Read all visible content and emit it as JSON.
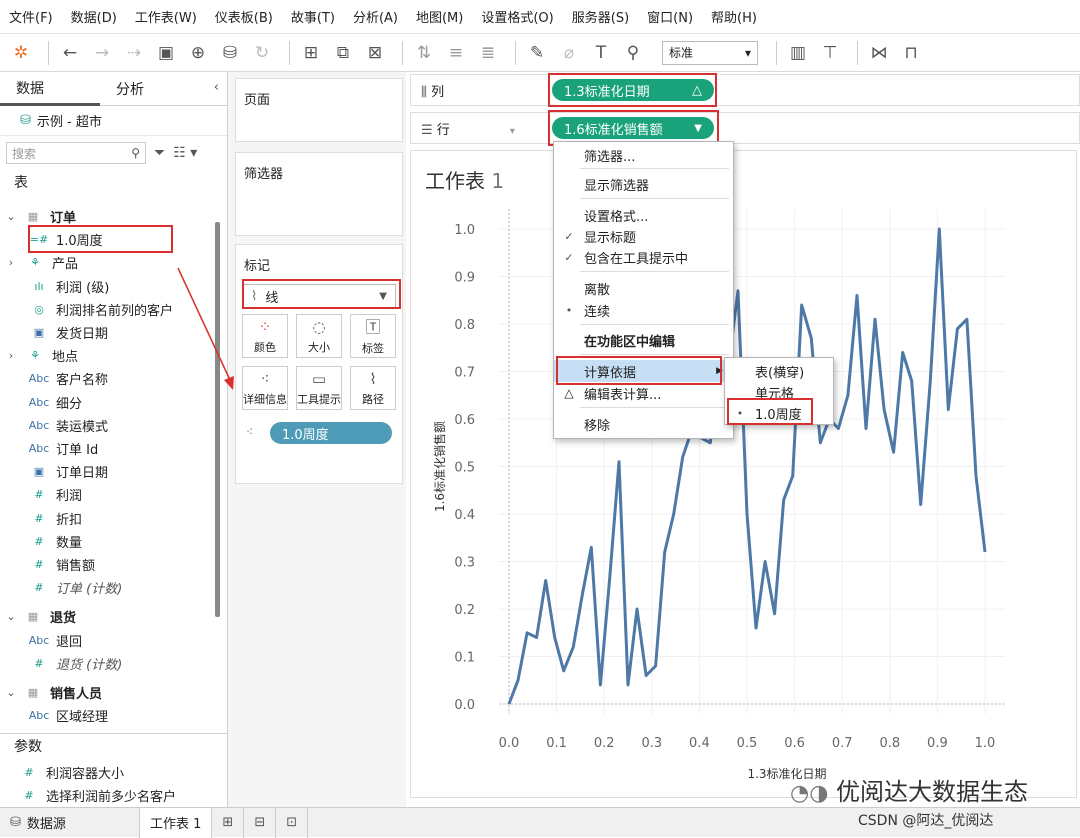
{
  "menubar": [
    "文件(F)",
    "数据(D)",
    "工作表(W)",
    "仪表板(B)",
    "故事(T)",
    "分析(A)",
    "地图(M)",
    "设置格式(O)",
    "服务器(S)",
    "窗口(N)",
    "帮助(H)"
  ],
  "toolbar": {
    "fit_select": "标准"
  },
  "left": {
    "tab_data": "数据",
    "tab_analysis": "分析",
    "datasource": "示例 - 超市",
    "search_placeholder": "搜索",
    "tables_heading": "表",
    "fields": [
      {
        "label": "订单",
        "kind": "table",
        "bold": true,
        "expand": "⌄"
      },
      {
        "label": "1.0周度",
        "kind": "calc"
      },
      {
        "label": "产品",
        "kind": "hier",
        "expand": "›"
      },
      {
        "label": "利润 (级)",
        "kind": "bin"
      },
      {
        "label": "利润排名前列的客户",
        "kind": "set"
      },
      {
        "label": "发货日期",
        "kind": "date"
      },
      {
        "label": "地点",
        "kind": "hier",
        "expand": "›"
      },
      {
        "label": "客户名称",
        "kind": "abc"
      },
      {
        "label": "细分",
        "kind": "abc"
      },
      {
        "label": "装运模式",
        "kind": "abc"
      },
      {
        "label": "订单 Id",
        "kind": "abc"
      },
      {
        "label": "订单日期",
        "kind": "date"
      },
      {
        "label": "利润",
        "kind": "num"
      },
      {
        "label": "折扣",
        "kind": "num"
      },
      {
        "label": "数量",
        "kind": "num"
      },
      {
        "label": "销售额",
        "kind": "num"
      },
      {
        "label": "订单 (计数)",
        "kind": "num",
        "italic": true
      },
      {
        "label": "退货",
        "kind": "table",
        "bold": true,
        "expand": "⌄"
      },
      {
        "label": "退回",
        "kind": "abc"
      },
      {
        "label": "退货 (计数)",
        "kind": "num",
        "italic": true
      },
      {
        "label": "销售人员",
        "kind": "table",
        "bold": true,
        "expand": "⌄"
      },
      {
        "label": "区域经理",
        "kind": "abc"
      }
    ],
    "params_heading": "参数",
    "params": [
      "利润容器大小",
      "选择利润前多少名客户"
    ]
  },
  "cards": {
    "pages": "页面",
    "filters": "筛选器",
    "marks": "标记",
    "mark_type": "线",
    "mark_buttons": [
      "颜色",
      "大小",
      "标签",
      "详细信息",
      "工具提示",
      "路径"
    ],
    "detail_pill": "1.0周度"
  },
  "shelves": {
    "columns_label": "列",
    "rows_label": "行",
    "col_pill": "1.3标准化日期",
    "row_pill": "1.6标准化销售额"
  },
  "viz": {
    "sheet_title": "工作表",
    "sheet_num": "1"
  },
  "chart_data": {
    "type": "line",
    "xlabel": "1.3标准化日期",
    "ylabel": "1.6标准化销售额",
    "xlim": [
      0,
      1
    ],
    "ylim": [
      0,
      1
    ],
    "xticks": [
      "0.0",
      "0.1",
      "0.2",
      "0.3",
      "0.4",
      "0.5",
      "0.6",
      "0.7",
      "0.8",
      "0.9",
      "1.0"
    ],
    "yticks": [
      "0.0",
      "0.1",
      "0.2",
      "0.3",
      "0.4",
      "0.5",
      "0.6",
      "0.7",
      "0.8",
      "0.9",
      "1.0"
    ],
    "color": "#4e79a7",
    "x": [
      0.0,
      0.019,
      0.038,
      0.058,
      0.077,
      0.096,
      0.115,
      0.135,
      0.154,
      0.173,
      0.192,
      0.212,
      0.231,
      0.25,
      0.269,
      0.288,
      0.308,
      0.327,
      0.346,
      0.365,
      0.385,
      0.404,
      0.423,
      0.442,
      0.462,
      0.481,
      0.5,
      0.519,
      0.538,
      0.558,
      0.577,
      0.596,
      0.615,
      0.635,
      0.654,
      0.673,
      0.692,
      0.712,
      0.731,
      0.75,
      0.769,
      0.788,
      0.808,
      0.827,
      0.846,
      0.865,
      0.885,
      0.904,
      0.923,
      0.942,
      0.962,
      0.981,
      1.0
    ],
    "y": [
      0.0,
      0.05,
      0.15,
      0.14,
      0.26,
      0.14,
      0.07,
      0.12,
      0.23,
      0.33,
      0.04,
      0.27,
      0.51,
      0.04,
      0.2,
      0.06,
      0.08,
      0.32,
      0.4,
      0.52,
      0.58,
      0.56,
      0.55,
      0.7,
      0.72,
      0.87,
      0.4,
      0.16,
      0.3,
      0.19,
      0.43,
      0.48,
      0.84,
      0.77,
      0.55,
      0.6,
      0.58,
      0.65,
      0.86,
      0.58,
      0.81,
      0.62,
      0.53,
      0.74,
      0.68,
      0.42,
      0.68,
      1.0,
      0.62,
      0.79,
      0.81,
      0.48,
      0.32
    ]
  },
  "context_menu": {
    "items": [
      "筛选器...",
      "显示筛选器",
      "设置格式...",
      "显示标题",
      "包含在工具提示中",
      "离散",
      "连续",
      "在功能区中编辑",
      "计算依据",
      "编辑表计算...",
      "移除"
    ]
  },
  "submenu": {
    "items": [
      "表(横穿)",
      "单元格",
      "1.0周度"
    ]
  },
  "bottom": {
    "datasource_tab": "数据源",
    "sheet_tab": "工作表 1"
  },
  "watermark": "优阅达大数据生态",
  "csdn": "CSDN @阿达_优阅达"
}
